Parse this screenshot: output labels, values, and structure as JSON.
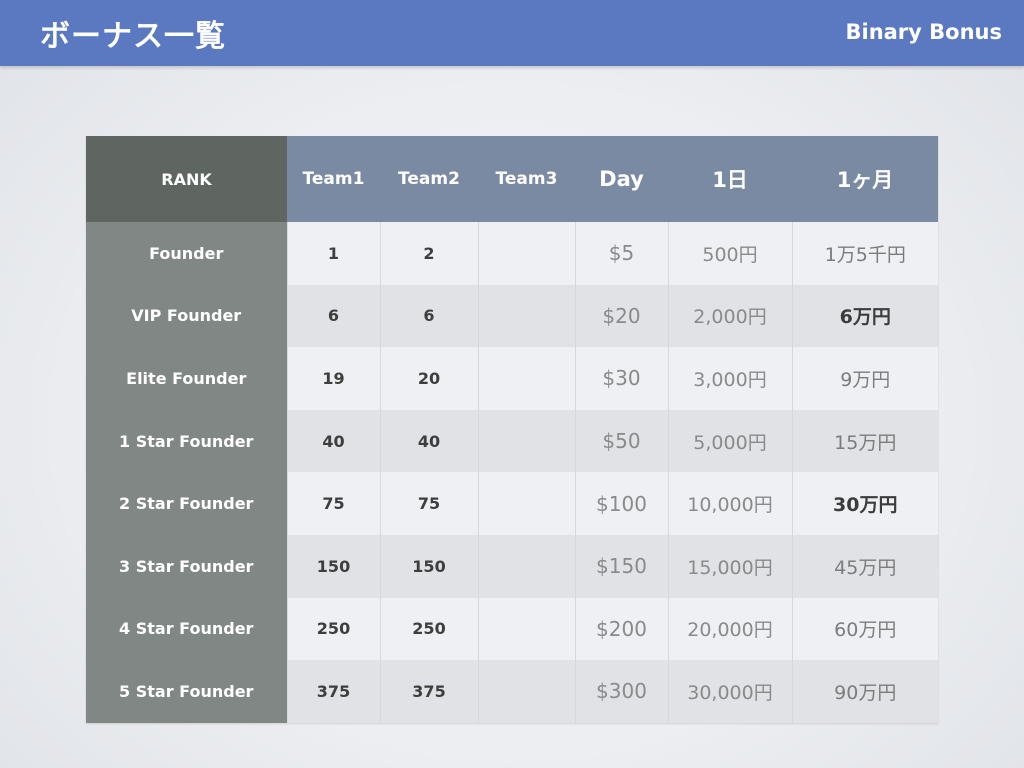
{
  "header": {
    "title": "ボーナス一覧",
    "subtitle": "Binary Bonus"
  },
  "table": {
    "columns": [
      "RANK",
      "Team1",
      "Team2",
      "Team3",
      "Day",
      "1日",
      "1ヶ月"
    ],
    "rows": [
      {
        "rank": "Founder",
        "team1": "1",
        "team2": "2",
        "team3": "",
        "day": "$5",
        "daily": "500円",
        "monthly": "1万5千円",
        "highlight": false
      },
      {
        "rank": "VIP Founder",
        "team1": "6",
        "team2": "6",
        "team3": "",
        "day": "$20",
        "daily": "2,000円",
        "monthly": "6万円",
        "highlight": true
      },
      {
        "rank": "Elite Founder",
        "team1": "19",
        "team2": "20",
        "team3": "",
        "day": "$30",
        "daily": "3,000円",
        "monthly": "9万円",
        "highlight": false
      },
      {
        "rank": "1 Star Founder",
        "team1": "40",
        "team2": "40",
        "team3": "",
        "day": "$50",
        "daily": "5,000円",
        "monthly": "15万円",
        "highlight": false
      },
      {
        "rank": "2 Star Founder",
        "team1": "75",
        "team2": "75",
        "team3": "",
        "day": "$100",
        "daily": "10,000円",
        "monthly": "30万円",
        "highlight": true
      },
      {
        "rank": "3 Star Founder",
        "team1": "150",
        "team2": "150",
        "team3": "",
        "day": "$150",
        "daily": "15,000円",
        "monthly": "45万円",
        "highlight": false
      },
      {
        "rank": "4 Star Founder",
        "team1": "250",
        "team2": "250",
        "team3": "",
        "day": "$200",
        "daily": "20,000円",
        "monthly": "60万円",
        "highlight": false
      },
      {
        "rank": "5 Star Founder",
        "team1": "375",
        "team2": "375",
        "team3": "",
        "day": "$300",
        "daily": "30,000円",
        "monthly": "90万円",
        "highlight": false
      }
    ]
  },
  "colors": {
    "title_bar": "#5b79c1",
    "header_row": "#7a8aa3",
    "rank_header": "#5f6561",
    "rank_column": "#808784",
    "row_light": "#eef0f4",
    "row_dark": "#e1e2e6"
  }
}
